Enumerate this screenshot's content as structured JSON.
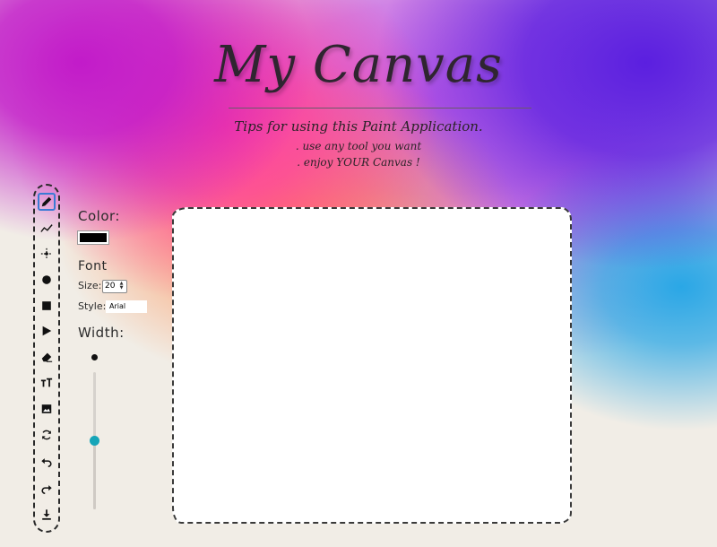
{
  "header": {
    "title": "My Canvas",
    "tips_heading": "Tips for using this Paint Application.",
    "tips": [
      ". use any tool you want",
      ". enjoy YOUR Canvas !"
    ]
  },
  "toolbar": {
    "active_tool": "pencil",
    "tools": [
      {
        "name": "pencil",
        "icon": "pencil-icon"
      },
      {
        "name": "line",
        "icon": "line-icon"
      },
      {
        "name": "spray",
        "icon": "spray-icon"
      },
      {
        "name": "circle",
        "icon": "circle-icon"
      },
      {
        "name": "square",
        "icon": "square-icon"
      },
      {
        "name": "triangle",
        "icon": "triangle-icon"
      },
      {
        "name": "eraser",
        "icon": "eraser-icon"
      },
      {
        "name": "text",
        "icon": "text-icon"
      },
      {
        "name": "image",
        "icon": "image-icon"
      },
      {
        "name": "clear",
        "icon": "refresh-icon"
      },
      {
        "name": "undo",
        "icon": "undo-icon"
      },
      {
        "name": "redo",
        "icon": "redo-icon"
      },
      {
        "name": "download",
        "icon": "download-icon"
      }
    ]
  },
  "settings": {
    "color_label": "Color:",
    "color_value": "#000000",
    "font_label": "Font",
    "size_label": "Size:",
    "size_value": "20",
    "style_label": "Style:",
    "style_value": "Arial",
    "width_label": "Width:",
    "width_fraction": 0.5
  },
  "colors": {
    "slider_thumb": "#16a5b8",
    "active_tool_border": "#3a7bd5"
  }
}
